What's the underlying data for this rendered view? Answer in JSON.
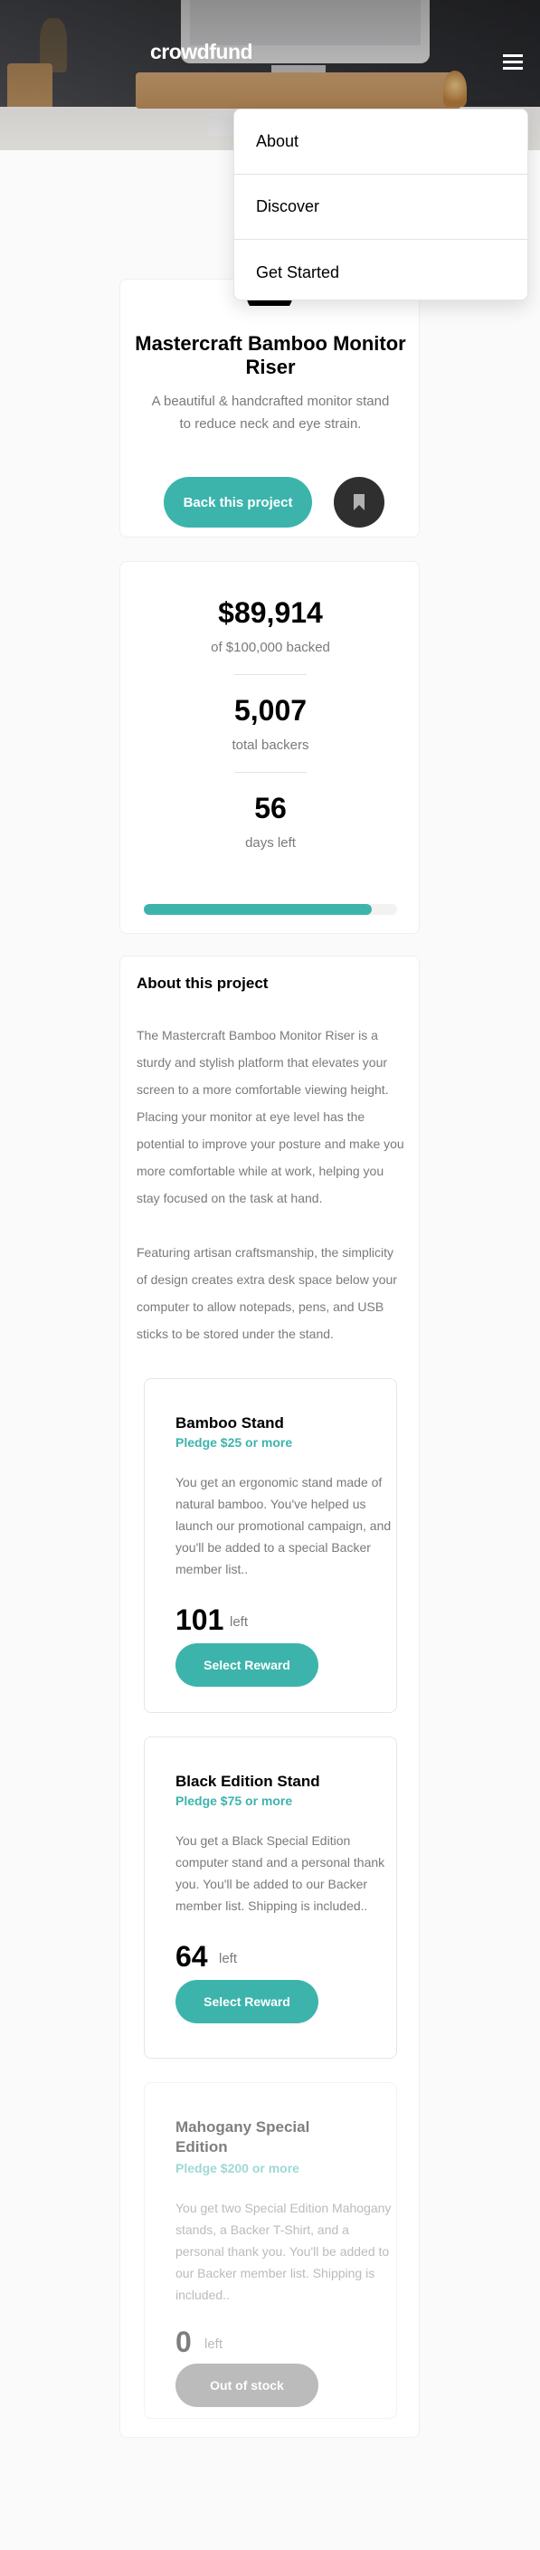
{
  "header": {
    "logo": "crowdfund"
  },
  "nav": {
    "items": [
      {
        "label": "About"
      },
      {
        "label": "Discover"
      },
      {
        "label": "Get Started"
      }
    ]
  },
  "intro": {
    "title": "Mastercraft Bamboo Monitor Riser",
    "description": "A beautiful & handcrafted monitor stand to reduce neck and eye strain.",
    "back_button": "Back this project"
  },
  "stats": {
    "backed_amount": "$89,914",
    "backed_label": "of $100,000 backed",
    "backers": "5,007",
    "backers_label": "total backers",
    "days": "56",
    "days_label": "days left",
    "progress_fraction": 0.899
  },
  "about": {
    "title": "About this project",
    "paragraphs": [
      "The Mastercraft Bamboo Monitor Riser is a sturdy and stylish platform that elevates your screen to a more comfortable viewing height. Placing your monitor at eye level has the potential to improve your posture and make you more comfortable while at work, helping you stay focused on the task at hand.",
      "Featuring artisan craftsmanship, the simplicity of design creates extra desk space below your computer to allow notepads, pens, and USB sticks to be stored under the stand."
    ]
  },
  "rewards": [
    {
      "name": "Bamboo Stand",
      "pledge": "Pledge $25 or more",
      "description": "You get an ergonomic stand made of natural bamboo. You've helped us launch our promotional campaign, and you'll be added to a special Backer member list..",
      "left": "101",
      "left_label": "left",
      "button": "Select Reward"
    },
    {
      "name": "Black Edition Stand",
      "pledge": "Pledge $75 or more",
      "description": "You get a Black Special Edition computer stand and a personal thank you. You'll be added to our Backer member list. Shipping is included..",
      "left": "64",
      "left_label": "left",
      "button": "Select Reward"
    },
    {
      "name": "Mahogany Special Edition",
      "pledge": "Pledge $200 or more",
      "description": "You get two Special Edition Mahogany stands, a Backer T-Shirt, and a personal thank you. You'll be added to our Backer member list. Shipping is included..",
      "left": "0",
      "left_label": "left",
      "button": "Out of stock"
    }
  ],
  "colors": {
    "accent": "#3cb4ac",
    "dark_accent": "#147a73",
    "text_muted": "#7a7a7a",
    "background": "#fafafa"
  },
  "icons": {
    "menu": "hamburger-icon",
    "bookmark": "bookmark-icon",
    "project_logo": "mastercraft-logo-icon"
  }
}
